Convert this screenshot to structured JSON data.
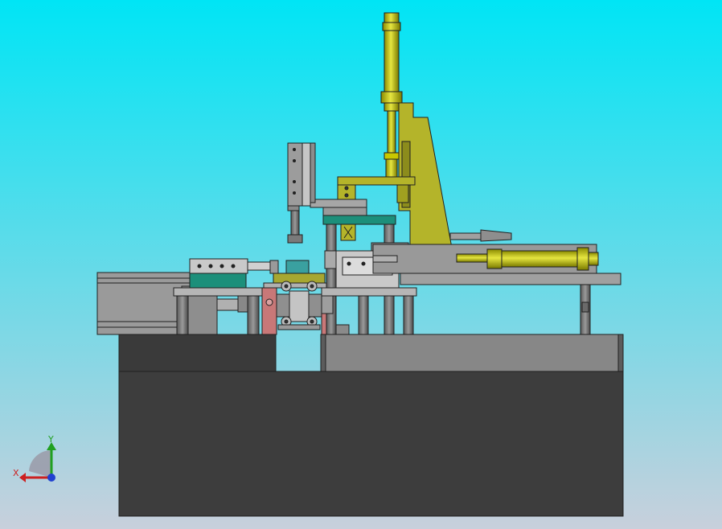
{
  "viewport": {
    "background_top": "#00e5f5",
    "background_bottom": "#c8d0dc"
  },
  "colors": {
    "base_dark": "#3d3d3d",
    "base_top": "#878787",
    "plate_gray": "#a8a8a8",
    "metal_light": "#c9c9c9",
    "metal_mid": "#8f8f8f",
    "cylinder_yellow": "#c8c800",
    "bracket_olive": "#b4b42a",
    "teal": "#1c8f7a",
    "teal_light": "#3aa0a0",
    "red_block": "#c87878",
    "outline": "#202020"
  },
  "triad": {
    "x_label": "X",
    "y_label": "Y",
    "x_color": "#cc2020",
    "y_color": "#20a020",
    "origin_color": "#2040d0"
  }
}
